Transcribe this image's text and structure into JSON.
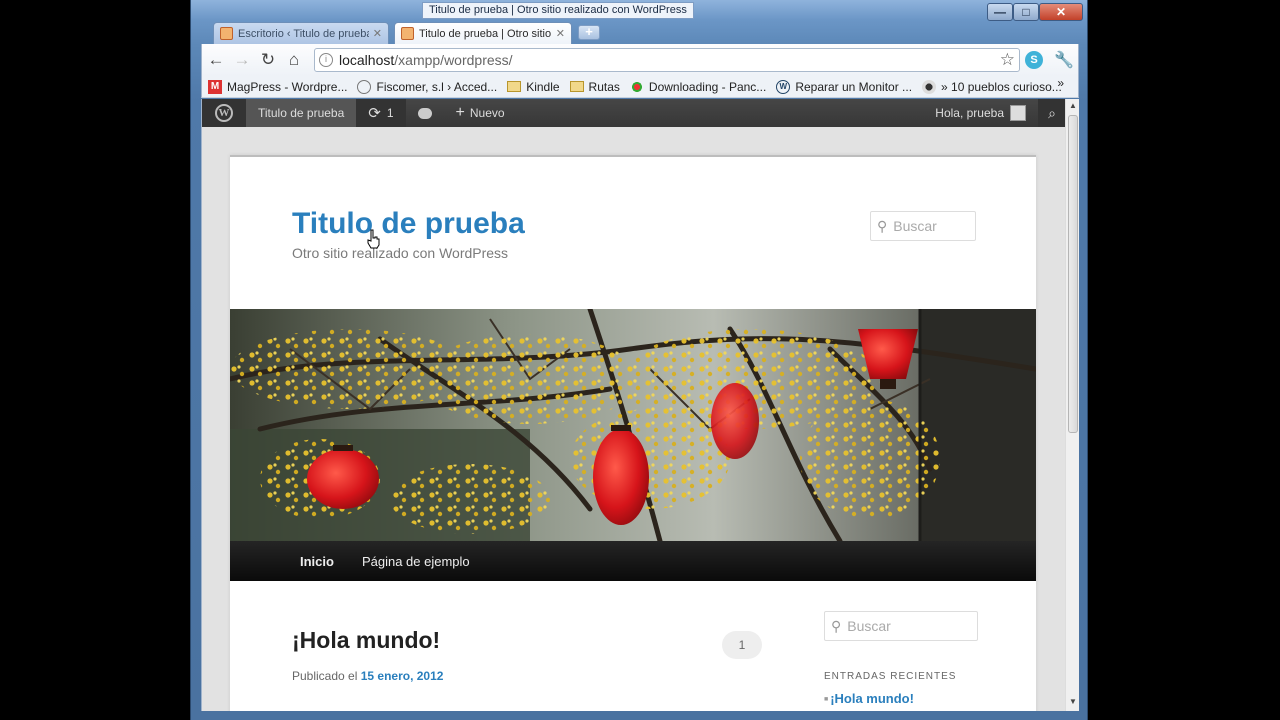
{
  "window": {
    "tooltip": "Titulo de prueba | Otro sitio realizado con WordPress",
    "min_glyph": "—",
    "max_glyph": "□",
    "close_glyph": "✕"
  },
  "tabs": [
    {
      "label": "Escritorio ‹ Titulo de prueba",
      "active": false
    },
    {
      "label": "Titulo de prueba | Otro sitio",
      "active": true
    }
  ],
  "toolbar": {
    "url_host": "localhost",
    "url_path": "/xampp/wordpress/",
    "back_glyph": "←",
    "forward_glyph": "→",
    "reload_glyph": "↻",
    "home_glyph": "⌂",
    "star_glyph": "☆",
    "wrench_glyph": "🔧"
  },
  "bookmarks": [
    {
      "label": "MagPress - Wordpre...",
      "icon": "magpress-icon"
    },
    {
      "label": "Fiscomer, s.l › Acced...",
      "icon": "globe-icon"
    },
    {
      "label": "Kindle",
      "icon": "folder-icon"
    },
    {
      "label": "Rutas",
      "icon": "folder-icon"
    },
    {
      "label": "Downloading - Panc...",
      "icon": "flower-icon"
    },
    {
      "label": "Reparar un Monitor ...",
      "icon": "wordpress-icon"
    },
    {
      "label": "» 10 pueblos curioso...",
      "icon": "dog-icon"
    }
  ],
  "bookmarks_more": "»",
  "adminbar": {
    "site_name": "Titulo de prueba",
    "updates_count": "1",
    "new_label": "Nuevo",
    "greeting": "Hola, prueba"
  },
  "site": {
    "title": "Titulo de prueba",
    "description": "Otro sitio realizado con WordPress",
    "search_placeholder": "Buscar"
  },
  "menu": [
    {
      "label": "Inicio"
    },
    {
      "label": "Página de ejemplo"
    }
  ],
  "post": {
    "title": "¡Hola mundo!",
    "meta_prefix": "Publicado el",
    "date": "15 enero, 2012",
    "comments": "1"
  },
  "sidebar": {
    "search_placeholder": "Buscar",
    "widget_title": "ENTRADAS RECIENTES",
    "recent": [
      "¡Hola mundo!"
    ]
  },
  "colors": {
    "link": "#2a7fbd",
    "admin_bar": "#464646",
    "menu_bar": "#1a1a1a"
  }
}
